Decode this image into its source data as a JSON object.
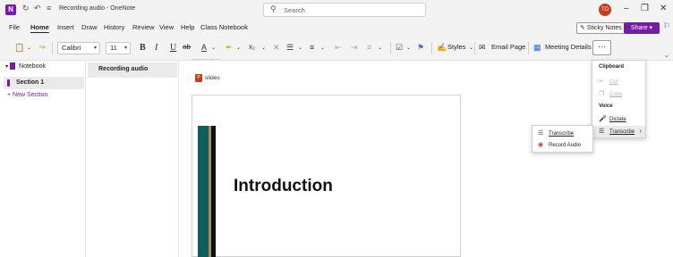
{
  "titlebar": {
    "title": "Recording audio - OneNote",
    "search_placeholder": "Search",
    "avatar_initials": "TO",
    "app_glyph": "N"
  },
  "menubar": {
    "items": [
      "File",
      "Home",
      "Insert",
      "Draw",
      "History",
      "Review",
      "View",
      "Help",
      "Class Notebook"
    ],
    "active": "Home",
    "sticky_notes": "Sticky Notes",
    "share": "Share"
  },
  "ribbon": {
    "font_name": "Calibri",
    "font_size": "11",
    "bold": "B",
    "italic": "I",
    "underline": "U",
    "styles": "Styles",
    "email_page": "Email Page",
    "meeting_details": "Meeting Details",
    "more": "···"
  },
  "sidebar": {
    "notebook": "Notebook",
    "section": "Section 1",
    "new_section": "New Section"
  },
  "pagelist": {
    "active_page": "Recording audio"
  },
  "canvas": {
    "attachment": "slides",
    "slide_title": "Introduction"
  },
  "panel": {
    "clipboard_header": "Clipboard",
    "cut": "Cut",
    "copy": "Copy",
    "voice_header": "Voice",
    "dictate": "Dictate",
    "transcribe": "Transcribe"
  },
  "submenu": {
    "transcribe": "Transcribe",
    "record_audio": "Record Audio"
  },
  "colors": {
    "accent": "#7719aa",
    "avatar": "#c43e1c"
  }
}
